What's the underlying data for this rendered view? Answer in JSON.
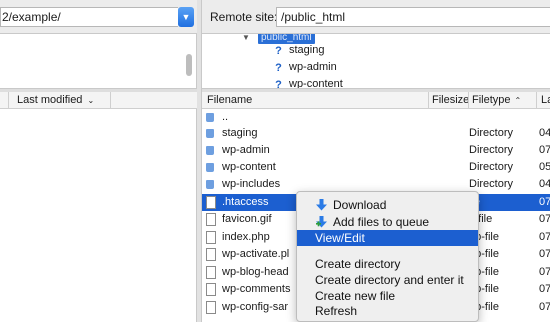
{
  "local": {
    "path": "2/example/",
    "columns": {
      "last_modified": "Last modified"
    }
  },
  "remote": {
    "site_label": "Remote site:",
    "site_path": "/public_html",
    "tree": {
      "root": "public_html",
      "items": [
        "staging",
        "wp-admin",
        "wp-content"
      ]
    },
    "columns": {
      "filename": "Filename",
      "filesize": "Filesize",
      "filetype": "Filetype",
      "last": "La"
    },
    "files": [
      {
        "icon": "folder-icon",
        "name": "..",
        "type": "",
        "last": ""
      },
      {
        "icon": "folder-icon",
        "name": "staging",
        "type": "Directory",
        "last": "04"
      },
      {
        "icon": "folder-icon",
        "name": "wp-admin",
        "type": "Directory",
        "last": "07"
      },
      {
        "icon": "folder-icon",
        "name": "wp-content",
        "type": "Directory",
        "last": "05"
      },
      {
        "icon": "folder-icon",
        "name": "wp-includes",
        "type": "Directory",
        "last": "04"
      },
      {
        "icon": "file-icon",
        "name": ".htaccess",
        "type": "ile",
        "last": "07",
        "selected": true
      },
      {
        "icon": "file-icon",
        "name": "favicon.gif",
        "type": "if-file",
        "last": "07"
      },
      {
        "icon": "file-icon",
        "name": "index.php",
        "type": "hp-file",
        "last": "07"
      },
      {
        "icon": "file-icon",
        "name": "wp-activate.pl",
        "type": "hp-file",
        "last": "07"
      },
      {
        "icon": "file-icon",
        "name": "wp-blog-head",
        "type": "hp-file",
        "last": "07"
      },
      {
        "icon": "file-icon",
        "name": "wp-comments",
        "type": "hp-file",
        "last": "07"
      },
      {
        "icon": "file-icon",
        "name": "wp-config-sar",
        "type": "hp-file",
        "last": "07"
      }
    ]
  },
  "context_menu": {
    "download": "Download",
    "add_to_queue": "Add files to queue",
    "view_edit": "View/Edit",
    "create_directory": "Create directory",
    "create_directory_enter": "Create directory and enter it",
    "create_file": "Create new file",
    "refresh": "Refresh"
  },
  "colors": {
    "selection": "#1c5fd0",
    "accent_blue": "#1f6fe0",
    "folder": "#6e9fe0"
  }
}
